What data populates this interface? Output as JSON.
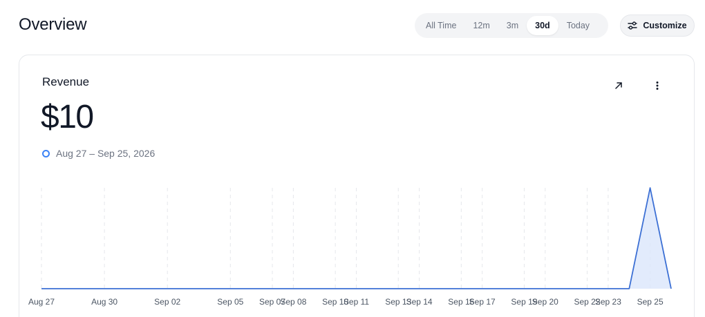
{
  "header": {
    "title": "Overview",
    "ranges": [
      {
        "label": "All Time",
        "active": false
      },
      {
        "label": "12m",
        "active": false
      },
      {
        "label": "3m",
        "active": false
      },
      {
        "label": "30d",
        "active": true
      },
      {
        "label": "Today",
        "active": false
      }
    ],
    "customize_label": "Customize",
    "customize_icon": "sliders-icon"
  },
  "card": {
    "title": "Revenue",
    "value": "$10",
    "date_range": "Aug 27 – Sep 25, 2026",
    "expand_icon": "arrow-up-right-icon",
    "more_icon": "more-vertical-icon"
  },
  "colors": {
    "accent": "#3b82f6",
    "line": "#3b6fd4",
    "fill": "#dbe6fb",
    "grid": "#e5e7eb",
    "tick_text": "#4b5563"
  },
  "chart_data": {
    "type": "area",
    "x_tick_labels": [
      "Aug 27",
      "Aug 30",
      "Sep 02",
      "Sep 05",
      "Sep 07",
      "Sep 08",
      "Sep 10",
      "Sep 11",
      "Sep 13",
      "Sep 14",
      "Sep 16",
      "Sep 17",
      "Sep 19",
      "Sep 20",
      "Sep 22",
      "Sep 23",
      "Sep 25"
    ],
    "x": [
      "Aug 27",
      "Aug 28",
      "Aug 29",
      "Aug 30",
      "Aug 31",
      "Sep 01",
      "Sep 02",
      "Sep 03",
      "Sep 04",
      "Sep 05",
      "Sep 06",
      "Sep 07",
      "Sep 08",
      "Sep 09",
      "Sep 10",
      "Sep 11",
      "Sep 12",
      "Sep 13",
      "Sep 14",
      "Sep 15",
      "Sep 16",
      "Sep 17",
      "Sep 18",
      "Sep 19",
      "Sep 20",
      "Sep 21",
      "Sep 22",
      "Sep 23",
      "Sep 24",
      "Sep 25",
      "Sep 26"
    ],
    "series": [
      {
        "values": [
          0,
          0,
          0,
          0,
          0,
          0,
          0,
          0,
          0,
          0,
          0,
          0,
          0,
          0,
          0,
          0,
          0,
          0,
          0,
          0,
          0,
          0,
          0,
          0,
          0,
          0,
          0,
          0,
          0,
          10,
          0
        ]
      }
    ],
    "ylim": [
      0,
      10
    ],
    "grid": "vertical-dashed",
    "legend": "none"
  }
}
